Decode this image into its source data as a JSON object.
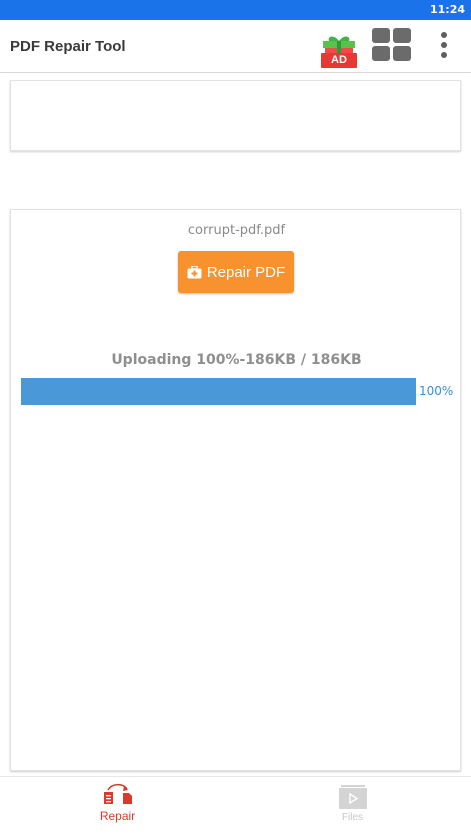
{
  "status_bar": {
    "time": "11:24"
  },
  "app_bar": {
    "title": "PDF Repair Tool",
    "ad_badge": "AD"
  },
  "main": {
    "file_name": "corrupt-pdf.pdf",
    "repair_button_label": "Repair PDF",
    "upload_status": "Uploading 100%-186KB / 186KB",
    "progress": {
      "percent": 100,
      "label": "100%"
    }
  },
  "bottom_nav": {
    "items": [
      {
        "label": "Repair",
        "active": true
      },
      {
        "label": "Files",
        "active": false
      }
    ]
  },
  "colors": {
    "status_bar": "#1a73e8",
    "accent_orange": "#f7922f",
    "progress_blue": "#4a98d8",
    "active_red": "#d93a2b",
    "inactive_gray": "#c8c8c8"
  },
  "icons": {
    "gift": "gift-ad-icon",
    "grid": "grid-view-icon",
    "more": "more-vert-icon",
    "repair_kit": "first-aid-kit-icon",
    "repair_nav": "repair-documents-icon",
    "files_nav": "files-play-icon"
  }
}
